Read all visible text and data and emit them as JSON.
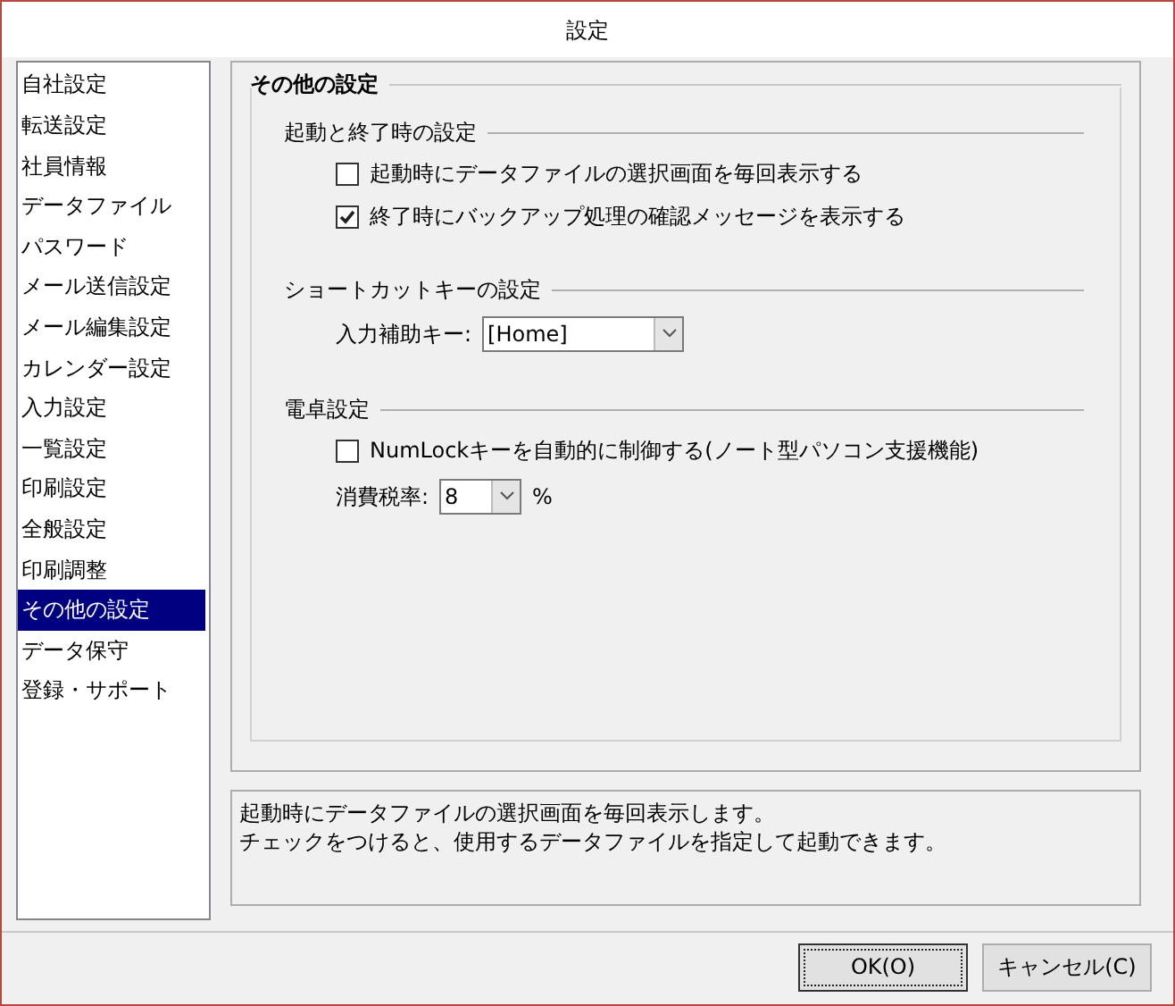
{
  "window": {
    "title": "設定"
  },
  "sidebar": {
    "items": [
      {
        "label": "自社設定",
        "selected": false
      },
      {
        "label": "転送設定",
        "selected": false
      },
      {
        "label": "社員情報",
        "selected": false
      },
      {
        "label": "データファイル",
        "selected": false
      },
      {
        "label": "パスワード",
        "selected": false
      },
      {
        "label": "メール送信設定",
        "selected": false
      },
      {
        "label": "メール編集設定",
        "selected": false
      },
      {
        "label": "カレンダー設定",
        "selected": false
      },
      {
        "label": "入力設定",
        "selected": false
      },
      {
        "label": "一覧設定",
        "selected": false
      },
      {
        "label": "印刷設定",
        "selected": false
      },
      {
        "label": "全般設定",
        "selected": false
      },
      {
        "label": "印刷調整",
        "selected": false
      },
      {
        "label": "その他の設定",
        "selected": true
      },
      {
        "label": "データ保守",
        "selected": false
      },
      {
        "label": "登録・サポート",
        "selected": false
      }
    ]
  },
  "section": {
    "title": "その他の設定",
    "groups": [
      {
        "title": "起動と終了時の設定",
        "items": [
          {
            "kind": "checkbox",
            "label": "起動時にデータファイルの選択画面を毎回表示する",
            "checked": false
          },
          {
            "kind": "checkbox",
            "label": "終了時にバックアップ処理の確認メッセージを表示する",
            "checked": true
          }
        ]
      },
      {
        "title": "ショートカットキーの設定",
        "items": [
          {
            "kind": "dropdown",
            "label": "入力補助キー:",
            "value": "[Home]"
          }
        ]
      },
      {
        "title": "電卓設定",
        "items": [
          {
            "kind": "checkbox",
            "label": "NumLockキーを自動的に制御する(ノート型パソコン支援機能)",
            "checked": false
          },
          {
            "kind": "short_dropdown",
            "label": "消費税率:",
            "value": "8",
            "suffix": "%"
          }
        ]
      }
    ]
  },
  "description": {
    "lines": [
      "起動時にデータファイルの選択画面を毎回表示します。",
      "チェックをつけると、使用するデータファイルを指定して起動できます。"
    ]
  },
  "buttons": [
    {
      "label": "OK(O)",
      "focused": true
    },
    {
      "label": "キャンセル(C)",
      "focused": false
    }
  ]
}
